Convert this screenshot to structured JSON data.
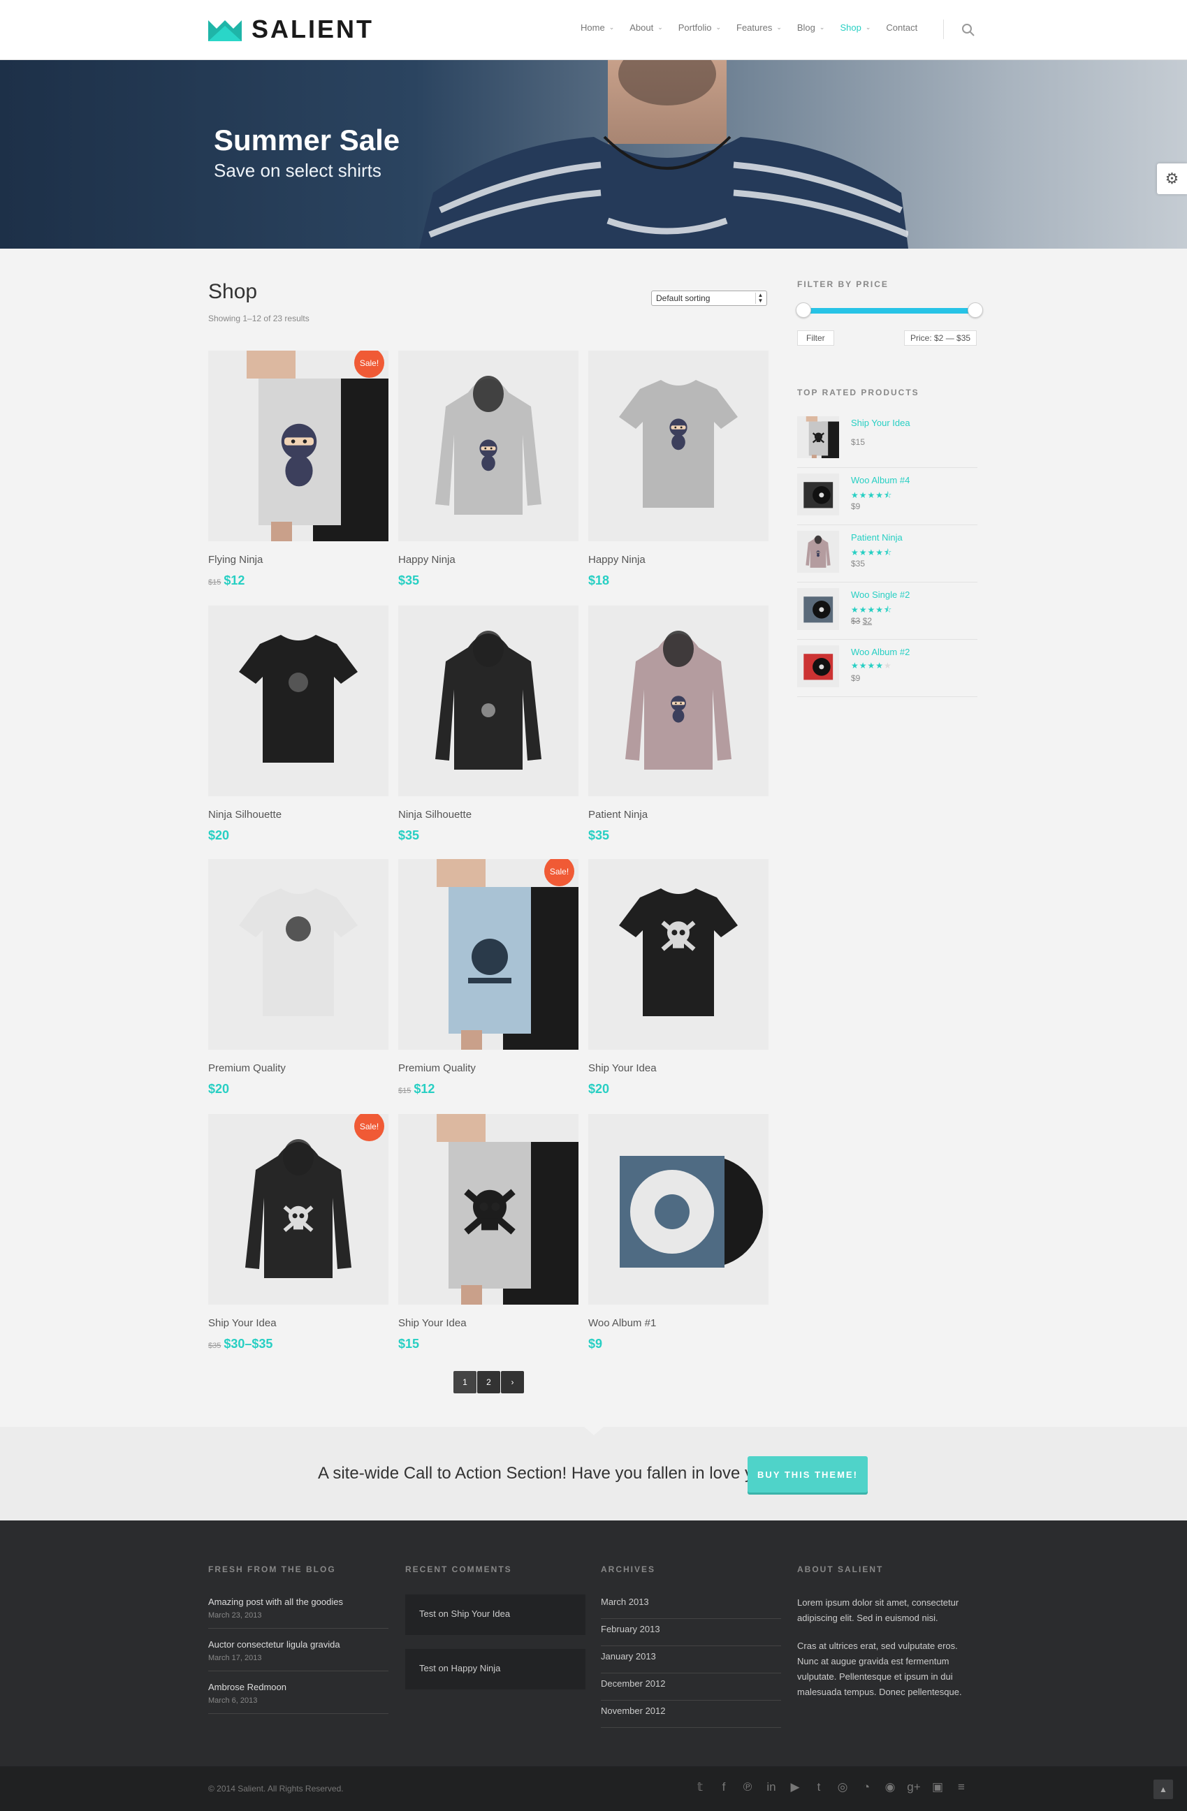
{
  "header": {
    "logo_text": "SALIENT",
    "nav": [
      {
        "label": "Home",
        "dropdown": true
      },
      {
        "label": "About",
        "dropdown": true
      },
      {
        "label": "Portfolio",
        "dropdown": true
      },
      {
        "label": "Features",
        "dropdown": true
      },
      {
        "label": "Blog",
        "dropdown": true
      },
      {
        "label": "Shop",
        "dropdown": true,
        "active": true
      },
      {
        "label": "Contact",
        "dropdown": false
      }
    ],
    "search_icon": "search-icon"
  },
  "hero": {
    "title": "Summer Sale",
    "subtitle": "Save on select shirts",
    "settings_icon": "gear-icon"
  },
  "shop": {
    "title": "Shop",
    "result_count": "Showing 1–12 of 23 results",
    "sort_value": "Default sorting",
    "sale_badge": "Sale!",
    "products": [
      {
        "name": "Flying Ninja",
        "old_price": "$15",
        "price": "$12",
        "sale": true,
        "kind": "poster-ninja"
      },
      {
        "name": "Happy Ninja",
        "old_price": "",
        "price": "$35",
        "sale": false,
        "kind": "hoodie-grey"
      },
      {
        "name": "Happy Ninja",
        "old_price": "",
        "price": "$18",
        "sale": false,
        "kind": "tshirt-grey"
      },
      {
        "name": "Ninja Silhouette",
        "old_price": "",
        "price": "$20",
        "sale": false,
        "kind": "tshirt-black"
      },
      {
        "name": "Ninja Silhouette",
        "old_price": "",
        "price": "$35",
        "sale": false,
        "kind": "hoodie-black"
      },
      {
        "name": "Patient Ninja",
        "old_price": "",
        "price": "$35",
        "sale": false,
        "kind": "hoodie-pink"
      },
      {
        "name": "Premium Quality",
        "old_price": "",
        "price": "$20",
        "sale": false,
        "kind": "tshirt-white"
      },
      {
        "name": "Premium Quality",
        "old_price": "$15",
        "price": "$12",
        "sale": true,
        "kind": "poster-blue"
      },
      {
        "name": "Ship Your Idea",
        "old_price": "",
        "price": "$20",
        "sale": false,
        "kind": "tshirt-black-skull"
      },
      {
        "name": "Ship Your Idea",
        "old_price": "$35",
        "price": "$30–$35",
        "sale": true,
        "kind": "hoodie-black-skull"
      },
      {
        "name": "Ship Your Idea",
        "old_price": "",
        "price": "$15",
        "sale": false,
        "kind": "poster-skull"
      },
      {
        "name": "Woo Album #1",
        "old_price": "",
        "price": "$9",
        "sale": false,
        "kind": "album"
      }
    ],
    "pagination": [
      "1",
      "2",
      "›"
    ]
  },
  "sidebar": {
    "filter_title": "FILTER BY PRICE",
    "filter_button": "Filter",
    "price_range": "Price: $2 — $35",
    "top_rated_title": "TOP RATED PRODUCTS",
    "top_rated": [
      {
        "name": "Ship Your Idea",
        "rating": 0,
        "old_price": "",
        "price": "$15",
        "kind": "poster-skull"
      },
      {
        "name": "Woo Album #4",
        "rating": 4.5,
        "old_price": "",
        "price": "$9",
        "kind": "album-dark"
      },
      {
        "name": "Patient Ninja",
        "rating": 4.5,
        "old_price": "",
        "price": "$35",
        "kind": "hoodie-pink"
      },
      {
        "name": "Woo Single #2",
        "rating": 4.5,
        "old_price": "$3",
        "price": "$2",
        "kind": "single"
      },
      {
        "name": "Woo Album #2",
        "rating": 4,
        "old_price": "",
        "price": "$9",
        "kind": "album-red"
      }
    ]
  },
  "cta": {
    "text": "A site-wide Call to Action Section! Have you fallen in love yet?",
    "button": "BUY THIS THEME!"
  },
  "footer": {
    "blog_title": "FRESH FROM THE BLOG",
    "blog_posts": [
      {
        "title": "Amazing post with all the goodies",
        "date": "March 23, 2013"
      },
      {
        "title": "Auctor consectetur ligula gravida",
        "date": "March 17, 2013"
      },
      {
        "title": "Ambrose Redmoon",
        "date": "March 6, 2013"
      }
    ],
    "comments_title": "RECENT COMMENTS",
    "comments": [
      "Test on Ship Your Idea",
      "Test on Happy Ninja"
    ],
    "archives_title": "ARCHIVES",
    "archives": [
      "March 2013",
      "February 2013",
      "January 2013",
      "December 2012",
      "November 2012"
    ],
    "about_title": "ABOUT SALIENT",
    "about_p1": "Lorem ipsum dolor sit amet, consectetur adipiscing elit. Sed in euismod nisi.",
    "about_p2": "Cras at ultrices erat, sed vulputate eros. Nunc at augue gravida est fermentum vulputate. Pellentesque et ipsum in dui malesuada tempus. Donec pellentesque."
  },
  "copyright": {
    "text": "© 2014 Salient. All Rights Reserved.",
    "social_icons": [
      "twitter-icon",
      "facebook-icon",
      "pinterest-icon",
      "linkedin-icon",
      "youtube-icon",
      "tumblr-icon",
      "dribbble-icon",
      "rss-icon",
      "github-icon",
      "google-plus-icon",
      "instagram-icon",
      "stackexchange-icon"
    ],
    "to_top_icon": "arrow-up-icon"
  },
  "colors": {
    "accent": "#27cfc3",
    "sale": "#f05a35",
    "footer_bg": "#2b2c2e"
  }
}
